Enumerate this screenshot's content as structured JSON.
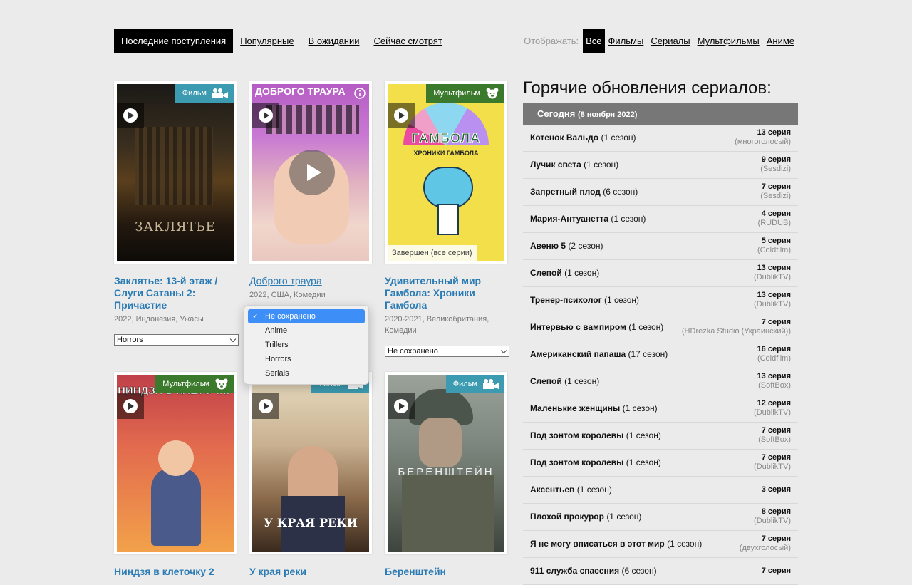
{
  "nav": {
    "tabs": [
      "Последние поступления",
      "Популярные",
      "В ожидании",
      "Сейчас смотрят"
    ],
    "filter_label": "Отображать:",
    "filters": [
      "Все",
      "Фильмы",
      "Сериалы",
      "Мультфильмы",
      "Аниме"
    ]
  },
  "cards": [
    {
      "badge": "Фильм",
      "badge_color": "#3c9bb0",
      "title": "Заклятье: 13-й этаж / Слуги Сатаны 2: Причастие",
      "meta": "2022, Индонезия, Ужасы",
      "select": "Horrors",
      "poster_text": "ЗАКЛЯТЬЕ"
    },
    {
      "badge": "",
      "badge_color": "#3c9bb0",
      "title": "Доброго траура",
      "meta": "2022, США, Комедии",
      "select": "",
      "poster_text": "ДОБРОГО ТРАУРА"
    },
    {
      "badge": "Мультфильм",
      "badge_color": "#3b7a2c",
      "title": "Удивительный мир Гамбола: Хроники Гамбола",
      "meta": "2020-2021, Великобритания, Комедии",
      "select": "Не сохранено",
      "status": "Завершен (все серии)",
      "poster_text": "ГАМБОЛА",
      "poster_sub": "ХРОНИКИ ГАМБОЛА"
    },
    {
      "badge": "Мультфильм",
      "badge_color": "#3b7a2c",
      "title": "Ниндзя в клеточку 2",
      "meta": "",
      "poster_text": "НИНДЗЯ В КЛЕТОЧКУ"
    },
    {
      "badge": "Фильм",
      "badge_color": "#3c9bb0",
      "title": "У края реки",
      "meta": "",
      "poster_text": "У КРАЯ РЕКИ"
    },
    {
      "badge": "Фильм",
      "badge_color": "#3c9bb0",
      "title": "Беренштейн",
      "meta": "",
      "poster_text": "БЕРЕНШТЕЙН"
    }
  ],
  "dropdown": {
    "options": [
      "Не сохранено",
      "Anime",
      "Trillers",
      "Horrors",
      "Serials"
    ],
    "selected": "Не сохранено"
  },
  "hot": {
    "title": "Горячие обновления сериалов:",
    "day": "Сегодня",
    "date": "(8 ноября 2022)",
    "rows": [
      {
        "name": "Котенок Вальдо",
        "season": "(1 сезон)",
        "ep": "13 серия",
        "src": "(многоголосый)"
      },
      {
        "name": "Лучик света",
        "season": "(1 сезон)",
        "ep": "9 серия",
        "src": "(Sesdizi)"
      },
      {
        "name": "Запретный плод",
        "season": "(6 сезон)",
        "ep": "7 серия",
        "src": "(Sesdizi)"
      },
      {
        "name": "Мария-Антуанетта",
        "season": "(1 сезон)",
        "ep": "4 серия",
        "src": "(RUDUB)"
      },
      {
        "name": "Авеню 5",
        "season": "(2 сезон)",
        "ep": "5 серия",
        "src": "(Coldfilm)"
      },
      {
        "name": "Слепой",
        "season": "(1 сезон)",
        "ep": "13 серия",
        "src": "(DublikTV)"
      },
      {
        "name": "Тренер-психолог",
        "season": "(1 сезон)",
        "ep": "13 серия",
        "src": "(DublikTV)"
      },
      {
        "name": "Интервью с вампиром",
        "season": "(1 сезон)",
        "ep": "7 серия",
        "src": "(HDrezka Studio (Украинский))"
      },
      {
        "name": "Американский папаша",
        "season": "(17 сезон)",
        "ep": "16 серия",
        "src": "(Coldfilm)"
      },
      {
        "name": "Слепой",
        "season": "(1 сезон)",
        "ep": "13 серия",
        "src": "(SoftBox)"
      },
      {
        "name": "Маленькие женщины",
        "season": "(1 сезон)",
        "ep": "12 серия",
        "src": "(DublikTV)"
      },
      {
        "name": "Под зонтом королевы",
        "season": "(1 сезон)",
        "ep": "7 серия",
        "src": "(SoftBox)"
      },
      {
        "name": "Под зонтом королевы",
        "season": "(1 сезон)",
        "ep": "7 серия",
        "src": "(DublikTV)"
      },
      {
        "name": "Аксентьев",
        "season": "(1 сезон)",
        "ep": "3 серия",
        "src": ""
      },
      {
        "name": "Плохой прокурор",
        "season": "(1 сезон)",
        "ep": "8 серия",
        "src": "(DublikTV)"
      },
      {
        "name": "Я не могу вписаться в этот мир",
        "season": "(1 сезон)",
        "ep": "7 серия",
        "src": "(двухголосый)"
      },
      {
        "name": "911 служба спасения",
        "season": "(6 сезон)",
        "ep": "7 серия",
        "src": ""
      }
    ]
  }
}
